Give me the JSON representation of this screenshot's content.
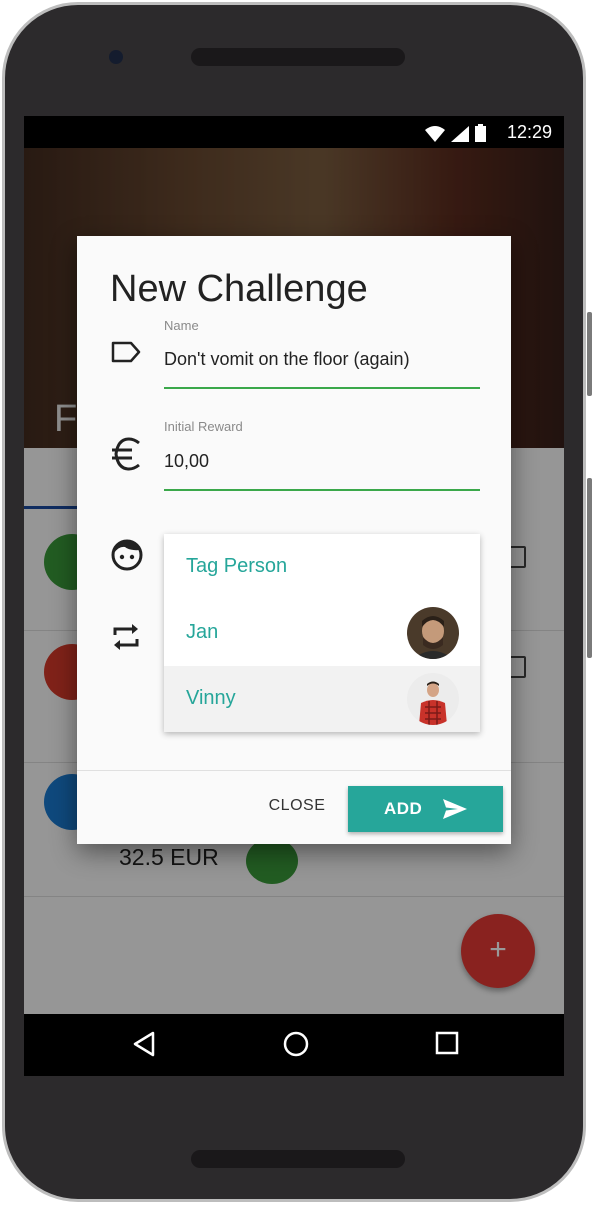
{
  "status_bar": {
    "time": "12:29",
    "icons": [
      "wifi-icon",
      "signal-icon",
      "battery-icon"
    ]
  },
  "background": {
    "hero_partial_title": "F",
    "amount": "32.5 EUR"
  },
  "dialog": {
    "title": "New Challenge",
    "name_field": {
      "label": "Name",
      "value": "Don't vomit on the floor (again)",
      "icon": "label-tag-icon"
    },
    "reward_field": {
      "label": "Initial Reward",
      "value": "10,00",
      "icon": "euro-icon"
    },
    "person_icon": "face-icon",
    "repeat_icon": "repeat-icon",
    "dropdown": {
      "items": [
        {
          "label": "Tag Person",
          "avatar": false
        },
        {
          "label": "Jan",
          "avatar": true
        },
        {
          "label": "Vinny",
          "avatar": true
        }
      ]
    },
    "buttons": {
      "close": "CLOSE",
      "add": "ADD"
    }
  },
  "fab": {
    "label": "+"
  },
  "colors": {
    "accent": "#26a69a",
    "underline": "#3aa84a",
    "fab": "#e53935"
  }
}
